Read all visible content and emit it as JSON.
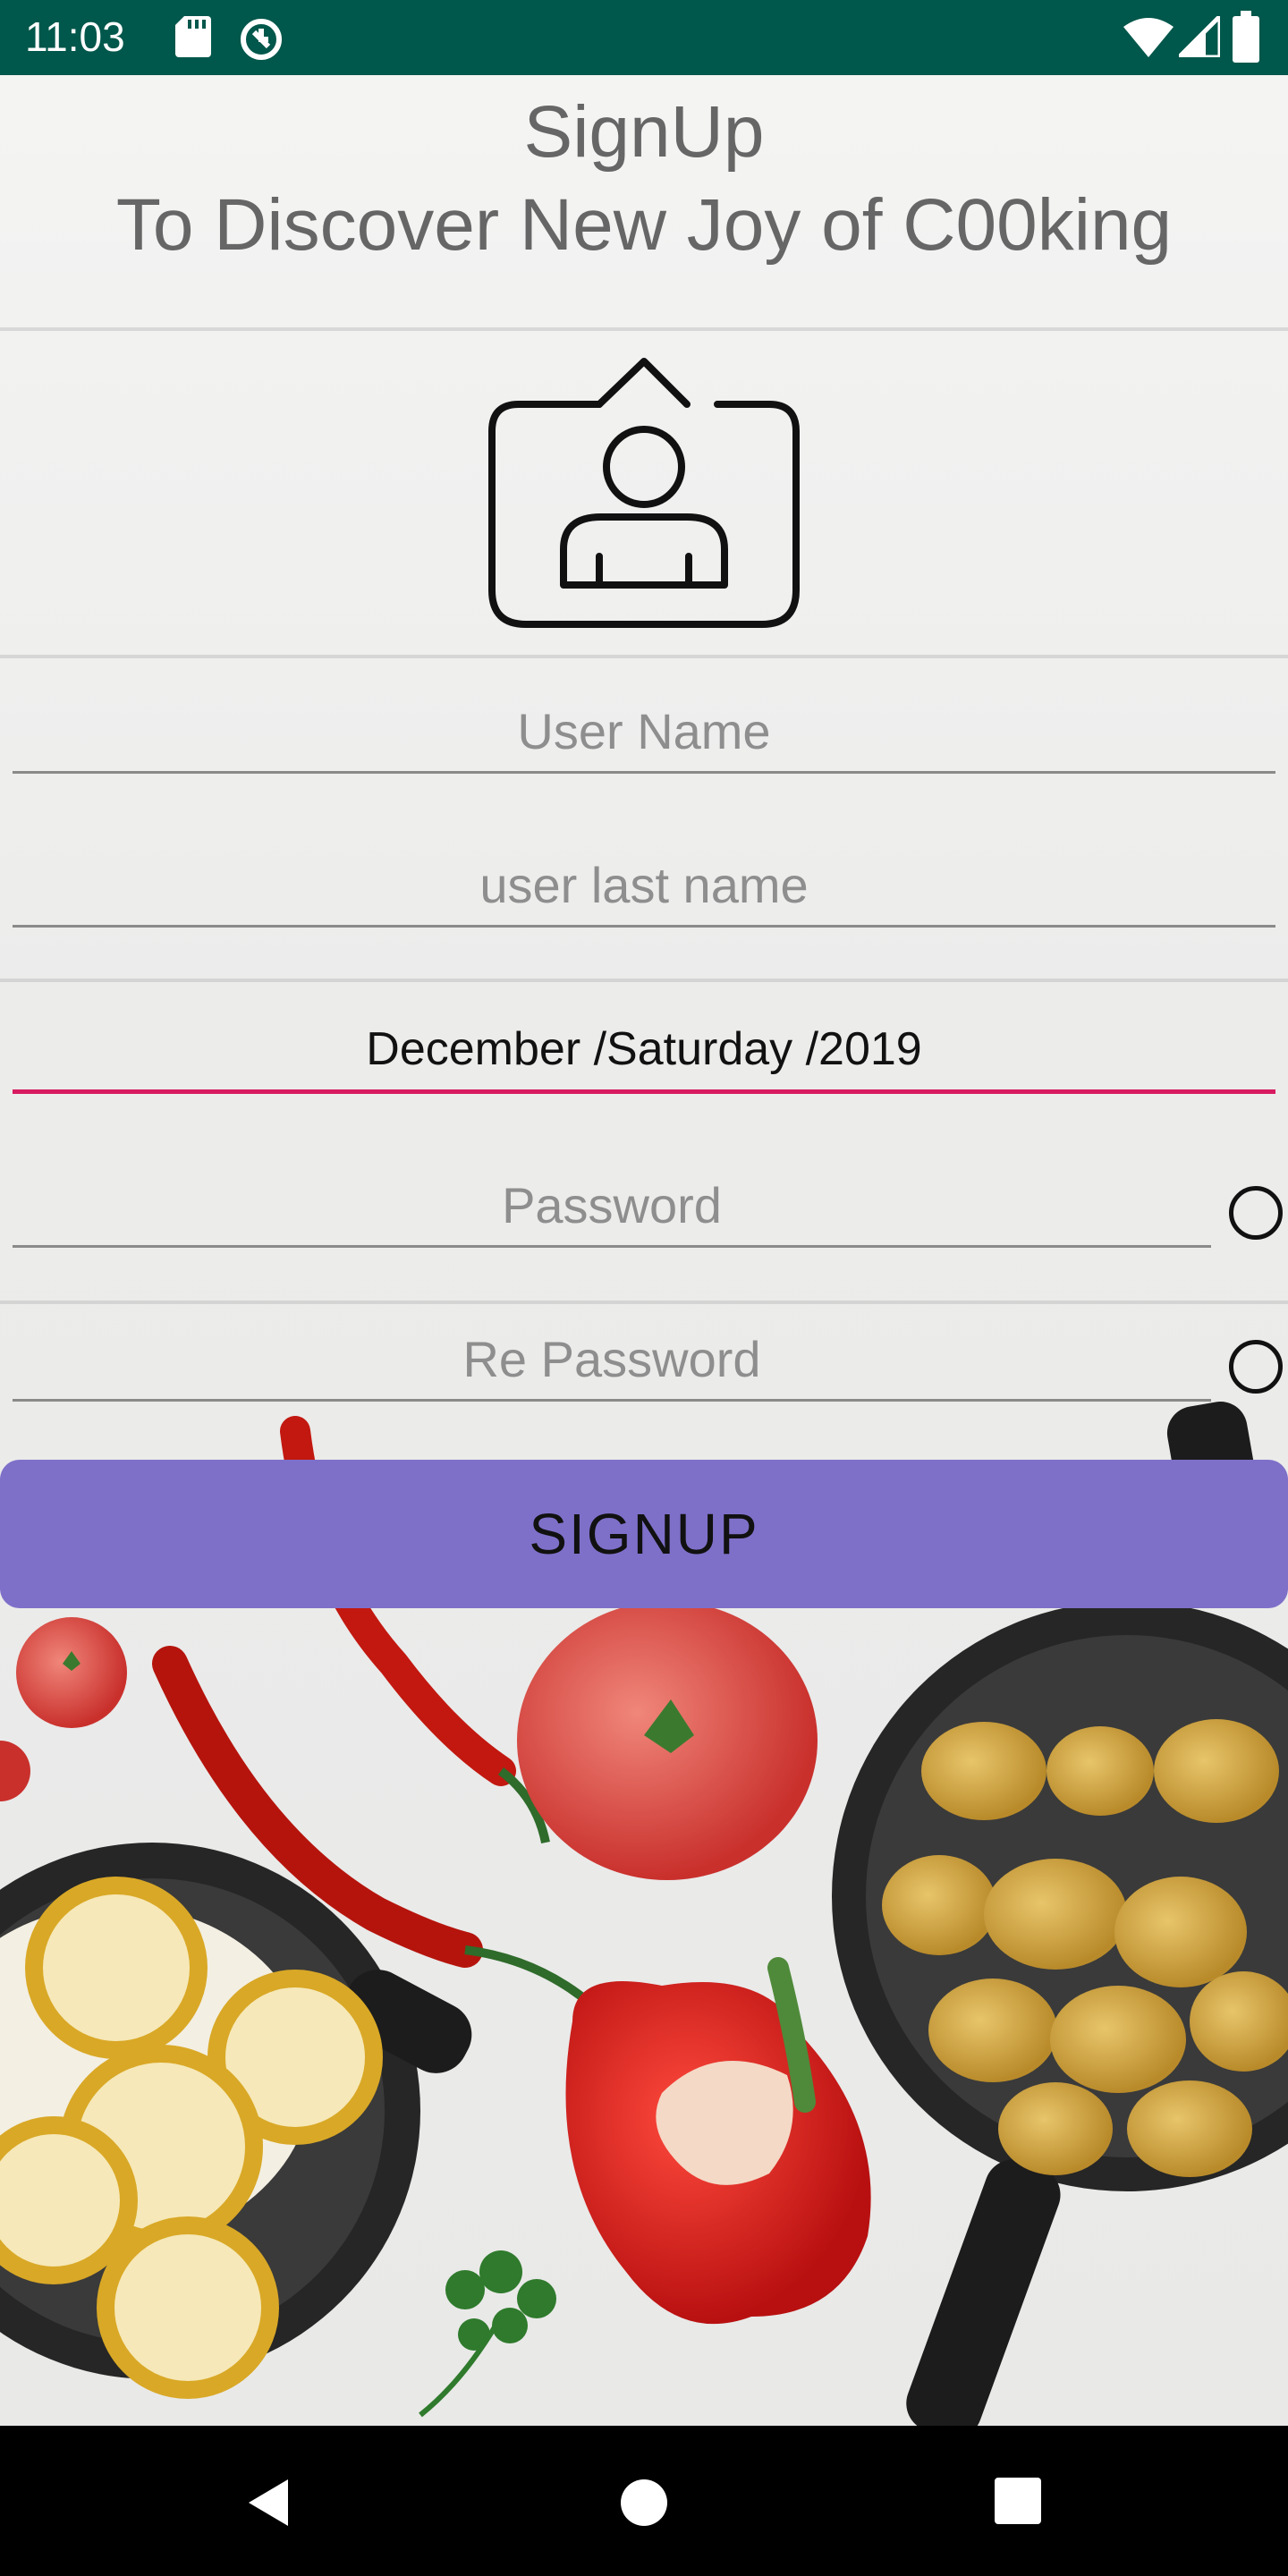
{
  "status_bar": {
    "time": "11:03",
    "icons": [
      "sd-card-icon",
      "sync-icon",
      "wifi-icon",
      "signal-icon",
      "battery-icon"
    ]
  },
  "header": {
    "title_line1": "SignUp",
    "title_line2": "To Discover New Joy of C00king"
  },
  "form": {
    "user_name_placeholder": "User Name",
    "last_name_placeholder": "user last name",
    "date_value": "December /Saturday /2019",
    "password_placeholder": "Password",
    "repassword_placeholder": "Re Password",
    "signup_label": "SIGNUP"
  },
  "colors": {
    "status_bar": "#00574b",
    "accent": "#d81b60",
    "button": "#7e70c9"
  },
  "nav_bar": {
    "icons": [
      "back-icon",
      "home-icon",
      "recents-icon"
    ]
  }
}
